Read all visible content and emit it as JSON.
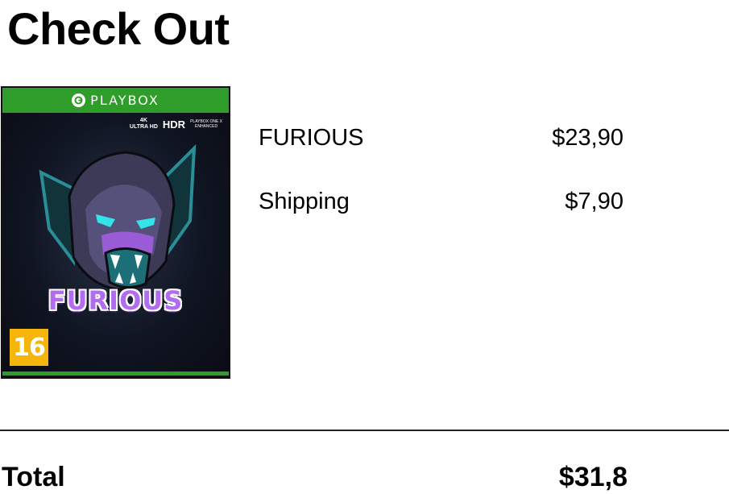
{
  "page": {
    "title": "Check Out"
  },
  "product_cover": {
    "brand": "PLAYBOX",
    "badge_4k": "4K\nULTRA HD",
    "badge_hdr": "HDR",
    "badge_enhanced": "PLAYBOX ONE X\nENHANCED",
    "game_title": "FURIOUS",
    "age_rating": "16",
    "colors": {
      "band": "#2f9d2a",
      "rating": "#f5b50a",
      "title": "#b26cf0"
    }
  },
  "order": {
    "items": [
      {
        "label": "FURIOUS",
        "price": "$23,90"
      },
      {
        "label": "Shipping",
        "price": "$7,90"
      }
    ],
    "total_label": "Total",
    "total_value": "$31,8"
  }
}
